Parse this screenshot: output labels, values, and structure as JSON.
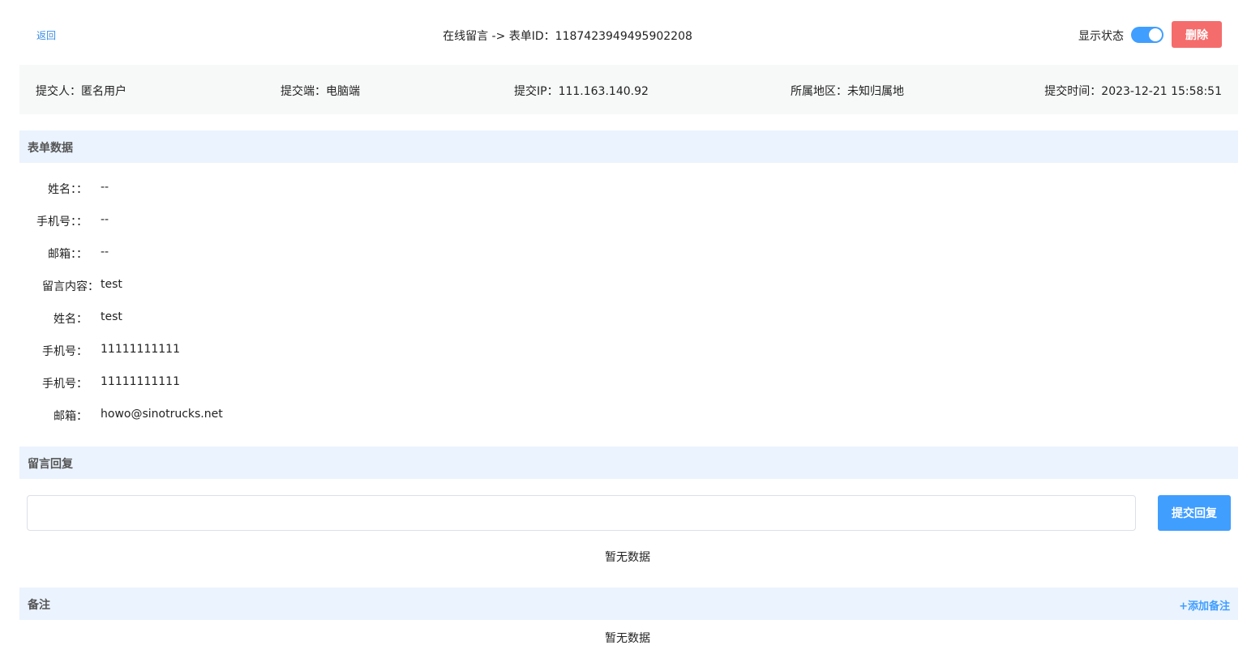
{
  "header": {
    "back_label": "返回",
    "title": "在线留言 -> 表单ID：1187423949495902208",
    "status_label": "显示状态",
    "status_on": true,
    "delete_label": "删除"
  },
  "meta": {
    "submitter": "提交人：匿名用户",
    "client": "提交端：电脑端",
    "ip": "提交IP：111.163.140.92",
    "region": "所属地区：未知归属地",
    "time": "提交时间：2023-12-21 15:58:51"
  },
  "form_section": {
    "title": "表单数据",
    "fields": [
      {
        "label": "姓名：：",
        "value": "--"
      },
      {
        "label": "手机号：：",
        "value": "--"
      },
      {
        "label": "邮箱：：",
        "value": "--"
      },
      {
        "label": "留言内容：",
        "value": "test"
      },
      {
        "label": "姓名：",
        "value": "test"
      },
      {
        "label": "手机号：",
        "value": "11111111111"
      },
      {
        "label": "手机号：",
        "value": "11111111111"
      },
      {
        "label": "邮箱：",
        "value": "howo@sinotrucks.net"
      }
    ]
  },
  "reply_section": {
    "title": "留言回复",
    "input_value": "",
    "submit_label": "提交回复",
    "empty_text": "暂无数据"
  },
  "remark_section": {
    "title": "备注",
    "add_label": "+添加备注",
    "empty_text": "暂无数据"
  },
  "colors": {
    "primary": "#409eff",
    "danger": "#f56c6c",
    "section_bg": "#ebf3fe",
    "meta_bg": "#f7f8f8"
  }
}
